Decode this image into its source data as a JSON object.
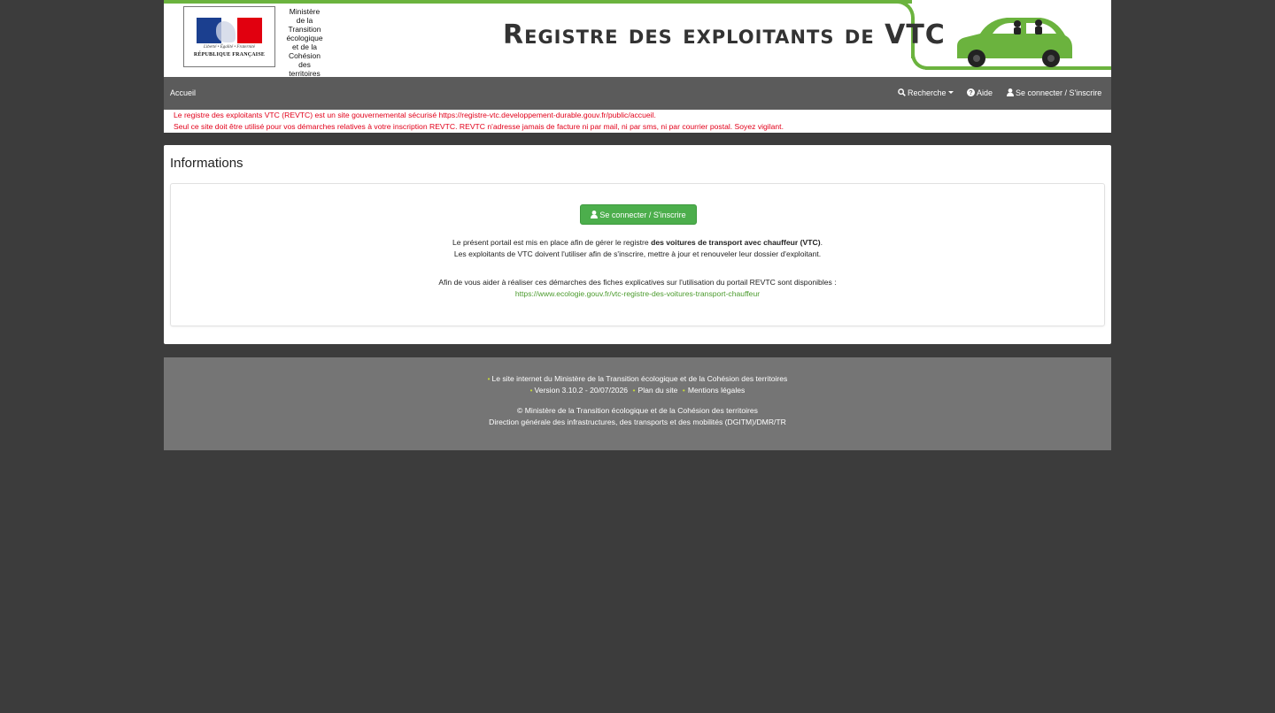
{
  "header": {
    "logo_motto": "Liberté • Égalité • Fraternité",
    "logo_republic": "RÉPUBLIQUE FRANÇAISE",
    "ministry_lines": [
      "Ministère",
      "de la",
      "Transition",
      "écologique",
      "et de la",
      "Cohésion",
      "des",
      "territoires"
    ],
    "site_title": "Registre des exploitants de VTC",
    "brand_color": "#6bb33e"
  },
  "nav": {
    "home": "Accueil",
    "search": "Recherche",
    "help": "Aide",
    "login": "Se connecter / S'inscrire"
  },
  "warning": {
    "line1": "Le registre des exploitants VTC (REVTC) est un site gouvernemental sécurisé https://registre-vtc.developpement-durable.gouv.fr/public/accueil.",
    "line2": "Seul ce site doit être utilisé pour vos démarches relatives à votre inscription REVTC. REVTC n'adresse jamais de facture ni par mail, ni par sms, ni par courrier postal. Soyez vigilant.",
    "color": "#e2001a"
  },
  "info": {
    "title": "Informations",
    "login_button": "Se connecter / S'inscrire",
    "para1_prefix": "Le présent portail est mis en place afin de gérer le registre",
    "para1_bold": "des voitures de transport avec chauffeur (VTC)",
    "para1_suffix": ".",
    "para1_line2": "Les exploitants de VTC doivent l'utiliser afin de s'inscrire, mettre à jour et renouveler leur dossier d'exploitant.",
    "para2_line1": "Afin de vous aider à réaliser ces démarches des fiches explicatives sur l'utilisation du portail REVTC sont disponibles :",
    "para2_link": "https://www.ecologie.gouv.fr/vtc-registre-des-voitures-transport-chauffeur"
  },
  "footer": {
    "ministry_site": "Le site internet du Ministère de la Transition écologique et de la Cohésion des territoires",
    "version": "Version 3.10.2 - 20/07/2026",
    "sitemap": "Plan du site",
    "legal": "Mentions légales",
    "copyright": "© Ministère de la Transition écologique et de la Cohésion des territoires",
    "direction": "Direction générale des infrastructures, des transports et des mobilités (DGITM)/DMR/TR"
  }
}
